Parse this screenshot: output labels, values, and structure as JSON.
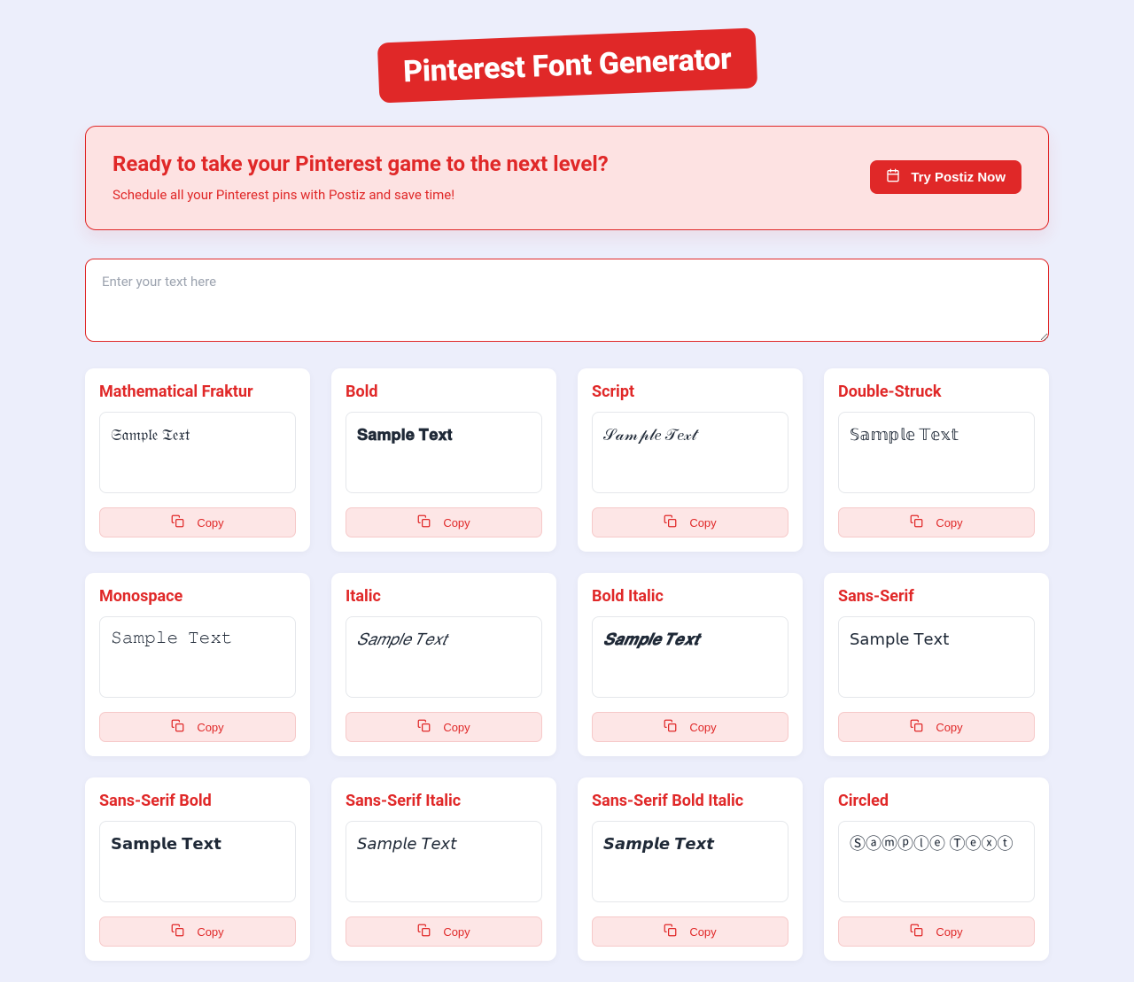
{
  "title": "Pinterest Font Generator",
  "promo": {
    "heading": "Ready to take your Pinterest game to the next level?",
    "sub": "Schedule all your Pinterest pins with Postiz and save time!",
    "button": "Try Postiz Now"
  },
  "input_placeholder": "Enter your text here",
  "copy_label": "Copy",
  "fonts": [
    {
      "name": "Mathematical Fraktur",
      "preview": "𝔖𝔞𝔪𝔭𝔩𝔢 𝔗𝔢𝔵𝔱",
      "style": ""
    },
    {
      "name": "Bold",
      "preview": "𝐒𝐚𝐦𝐩𝐥𝐞 𝐓𝐞𝐱𝐭",
      "style": "bold"
    },
    {
      "name": "Script",
      "preview": "𝒮𝒶𝓂𝓅𝓁𝑒 𝒯𝑒𝓍𝓉",
      "style": ""
    },
    {
      "name": "Double-Struck",
      "preview": "𝕊𝕒𝕞𝕡𝕝𝕖 𝕋𝕖𝕩𝕥",
      "style": ""
    },
    {
      "name": "Monospace",
      "preview": "𝚂𝚊𝚖𝚙𝚕𝚎 𝚃𝚎𝚡𝚝",
      "style": "mono"
    },
    {
      "name": "Italic",
      "preview": "𝑆𝑎𝑚𝑝𝑙𝑒 𝑇𝑒𝑥𝑡",
      "style": "italic"
    },
    {
      "name": "Bold Italic",
      "preview": "𝑺𝒂𝒎𝒑𝒍𝒆 𝑻𝒆𝒙𝒕",
      "style": "bolditalic"
    },
    {
      "name": "Sans-Serif",
      "preview": "𝖲𝖺𝗆𝗉𝗅𝖾 𝖳𝖾𝗑𝗍",
      "style": "sans"
    },
    {
      "name": "Sans-Serif Bold",
      "preview": "𝗦𝗮𝗺𝗽𝗹𝗲 𝗧𝗲𝘅𝘁",
      "style": "sans bold"
    },
    {
      "name": "Sans-Serif Italic",
      "preview": "𝘚𝘢𝘮𝘱𝘭𝘦 𝘛𝘦𝘹𝘵",
      "style": "sans italic"
    },
    {
      "name": "Sans-Serif Bold Italic",
      "preview": "𝙎𝙖𝙢𝙥𝙡𝙚 𝙏𝙚𝙭𝙩",
      "style": "sans bolditalic"
    },
    {
      "name": "Circled",
      "preview": "Ⓢⓐⓜⓟⓛⓔ Ⓣⓔⓧⓣ",
      "style": ""
    }
  ]
}
